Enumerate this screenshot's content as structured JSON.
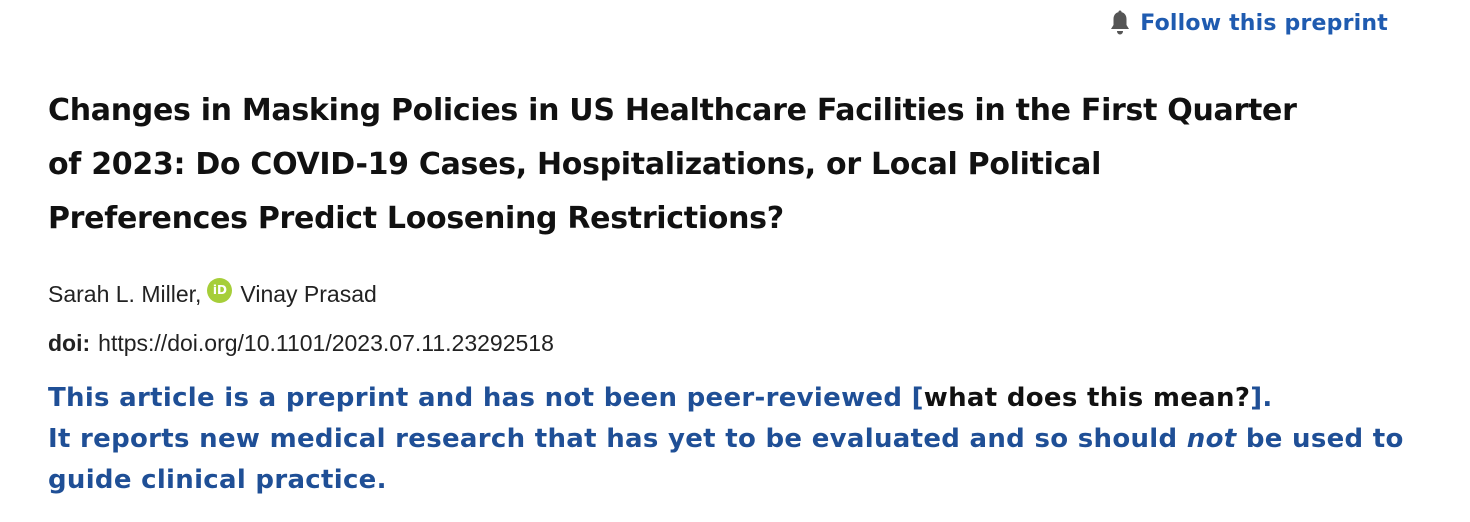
{
  "follow": {
    "label": "Follow this preprint",
    "icon": "bell-icon",
    "color": "#1f5bb0"
  },
  "article": {
    "title_lines": [
      "Changes in Masking Policies in US Healthcare Facilities in the First Quarter",
      "of 2023: Do COVID-19 Cases, Hospitalizations, or Local Political",
      "Preferences Predict Loosening Restrictions?"
    ],
    "authors": [
      {
        "name": "Sarah L. Miller,",
        "orcid": false
      },
      {
        "name": "Vinay Prasad",
        "orcid": true
      }
    ],
    "orcid_label": "iD",
    "doi_label": "doi:",
    "doi_url": "https://doi.org/10.1101/2023.07.11.23292518"
  },
  "notice": {
    "part1": "This article is a preprint and has not been peer-reviewed ",
    "bracket_open": "[",
    "link_text": "what does this mean?",
    "bracket_close": "].",
    "part2": "It reports new medical research that has yet to be evaluated and so should ",
    "emphasis": "not",
    "part3": " be used to guide clinical practice.",
    "color": "#1f4f96"
  }
}
